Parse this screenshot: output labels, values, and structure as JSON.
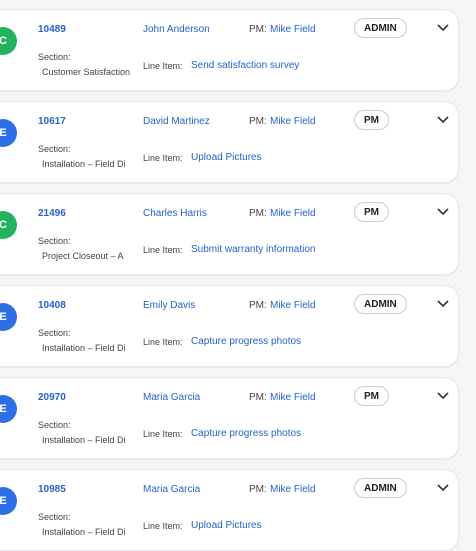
{
  "labels": {
    "section": "Section:",
    "line_item": "Line Item:",
    "pm": "PM:"
  },
  "colors": {
    "link": "#2563cc",
    "avatar_c": "#22b35e",
    "avatar_e": "#2f6fe6"
  },
  "cards": [
    {
      "initial": "C",
      "wo": "10489",
      "name": "John Anderson",
      "pm": "Mike Field",
      "role": "ADMIN",
      "section": "Customer Satisfaction",
      "line_item": "Send satisfaction survey"
    },
    {
      "initial": "E",
      "wo": "10617",
      "name": "David Martinez",
      "pm": "Mike Field",
      "role": "PM",
      "section": "Installation – Field Di",
      "line_item": "Upload Pictures"
    },
    {
      "initial": "C",
      "wo": "21496",
      "name": "Charles Harris",
      "pm": "Mike Field",
      "role": "PM",
      "section": "Project Closeout – A",
      "line_item": "Submit warranty information"
    },
    {
      "initial": "E",
      "wo": "10408",
      "name": "Emily Davis",
      "pm": "Mike Field",
      "role": "ADMIN",
      "section": "Installation – Field Di",
      "line_item": "Capture progress photos"
    },
    {
      "initial": "E",
      "wo": "20970",
      "name": "Maria Garcia",
      "pm": "Mike Field",
      "role": "PM",
      "section": "Installation – Field Di",
      "line_item": "Capture progress photos"
    },
    {
      "initial": "E",
      "wo": "10985",
      "name": "Maria Garcia",
      "pm": "Mike Field",
      "role": "ADMIN",
      "section": "Installation – Field Di",
      "line_item": "Upload Pictures"
    }
  ]
}
